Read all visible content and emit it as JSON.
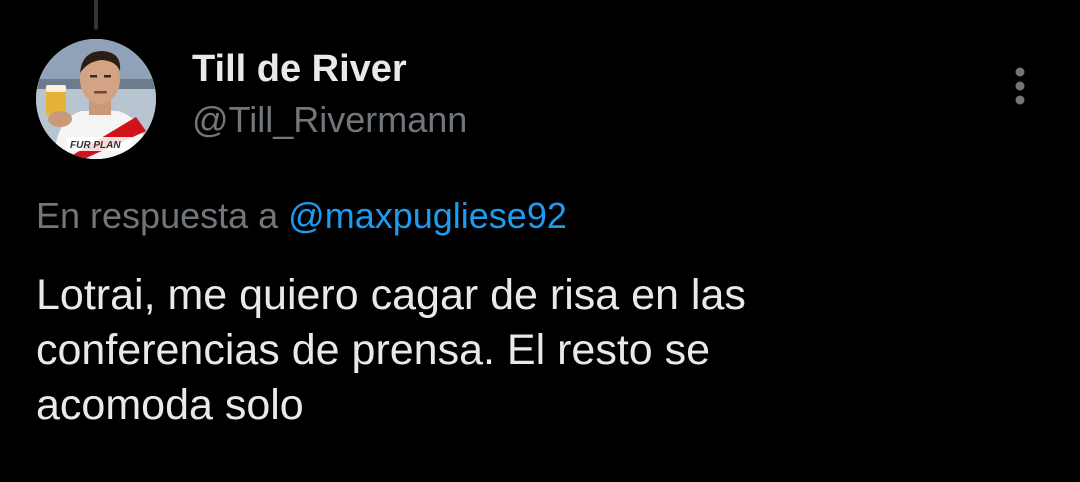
{
  "tweet": {
    "author": {
      "display_name": "Till de River",
      "handle": "@Till_Rivermann",
      "avatar_icon": "profile-photo",
      "avatar_caption": "FUR PLAN"
    },
    "more_icon": "more-vertical-icon",
    "reply": {
      "prefix": "En respuesta a",
      "mention": "@maxpugliese92"
    },
    "text": "Lotrai, me quiero cagar de risa en las\nconferencias de prensa. El resto se\nacomoda solo"
  },
  "colors": {
    "background": "#000000",
    "primary_text": "#e7e9ea",
    "secondary_text": "#71767b",
    "accent": "#1d9bf0"
  }
}
